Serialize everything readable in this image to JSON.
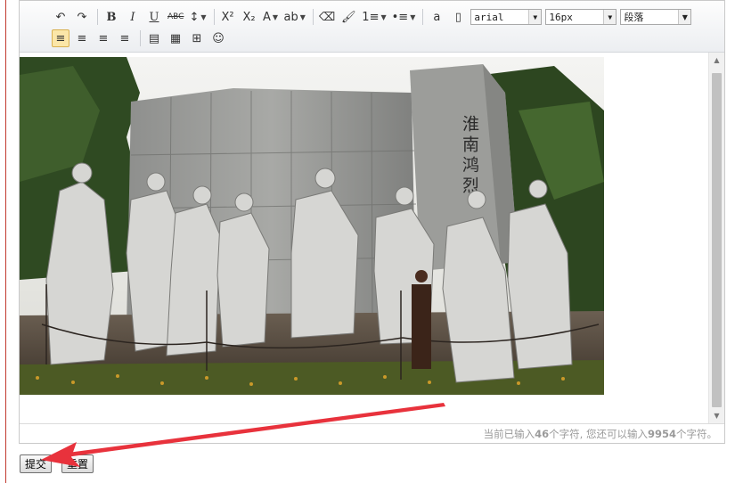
{
  "toolbar": {
    "row1": [
      {
        "name": "undo-icon",
        "glyph": "↶"
      },
      {
        "name": "redo-icon",
        "glyph": "↷"
      },
      {
        "name": "bold-button",
        "glyph": "B"
      },
      {
        "name": "italic-button",
        "glyph": "I"
      },
      {
        "name": "underline-button",
        "glyph": "U"
      },
      {
        "name": "strikethrough-button",
        "glyph": "ABC"
      },
      {
        "name": "line-height-icon",
        "glyph": "↕"
      },
      {
        "name": "superscript-button",
        "glyph": "X²"
      },
      {
        "name": "subscript-button",
        "glyph": "X₂"
      },
      {
        "name": "font-color-icon",
        "glyph": "A"
      },
      {
        "name": "highlight-color-icon",
        "glyph": "ab"
      },
      {
        "name": "eraser-icon",
        "glyph": "⌫"
      },
      {
        "name": "format-painter-icon",
        "glyph": "🖌"
      },
      {
        "name": "ordered-list-icon",
        "glyph": "1≡"
      },
      {
        "name": "unordered-list-icon",
        "glyph": "•≡"
      },
      {
        "name": "anchor-icon",
        "glyph": "a"
      },
      {
        "name": "page-icon",
        "glyph": "▯"
      }
    ],
    "font_family": "arial",
    "font_size": "16px",
    "paragraph": "段落",
    "row2": [
      {
        "name": "align-left-icon",
        "glyph": "≡",
        "active": true
      },
      {
        "name": "align-right-icon",
        "glyph": "≡"
      },
      {
        "name": "align-center-icon",
        "glyph": "≡"
      },
      {
        "name": "align-justify-icon",
        "glyph": "≡"
      },
      {
        "name": "video-icon",
        "glyph": "▤"
      },
      {
        "name": "insert-image-icon",
        "glyph": "▦"
      },
      {
        "name": "insert-table-icon",
        "glyph": "⊞"
      },
      {
        "name": "emoticon-icon",
        "glyph": "☺"
      }
    ]
  },
  "content": {
    "image_text": "淮南鸿烈"
  },
  "status": {
    "prefix": "当前已输入",
    "typed": "46",
    "middle": "个字符, 您还可以输入",
    "remaining": "9954",
    "suffix": "个字符。"
  },
  "form": {
    "submit_label": "提交",
    "reset_label": "重置"
  },
  "colors": {
    "annotation_arrow": "#e8323c",
    "left_rule": "#c23a2f"
  }
}
